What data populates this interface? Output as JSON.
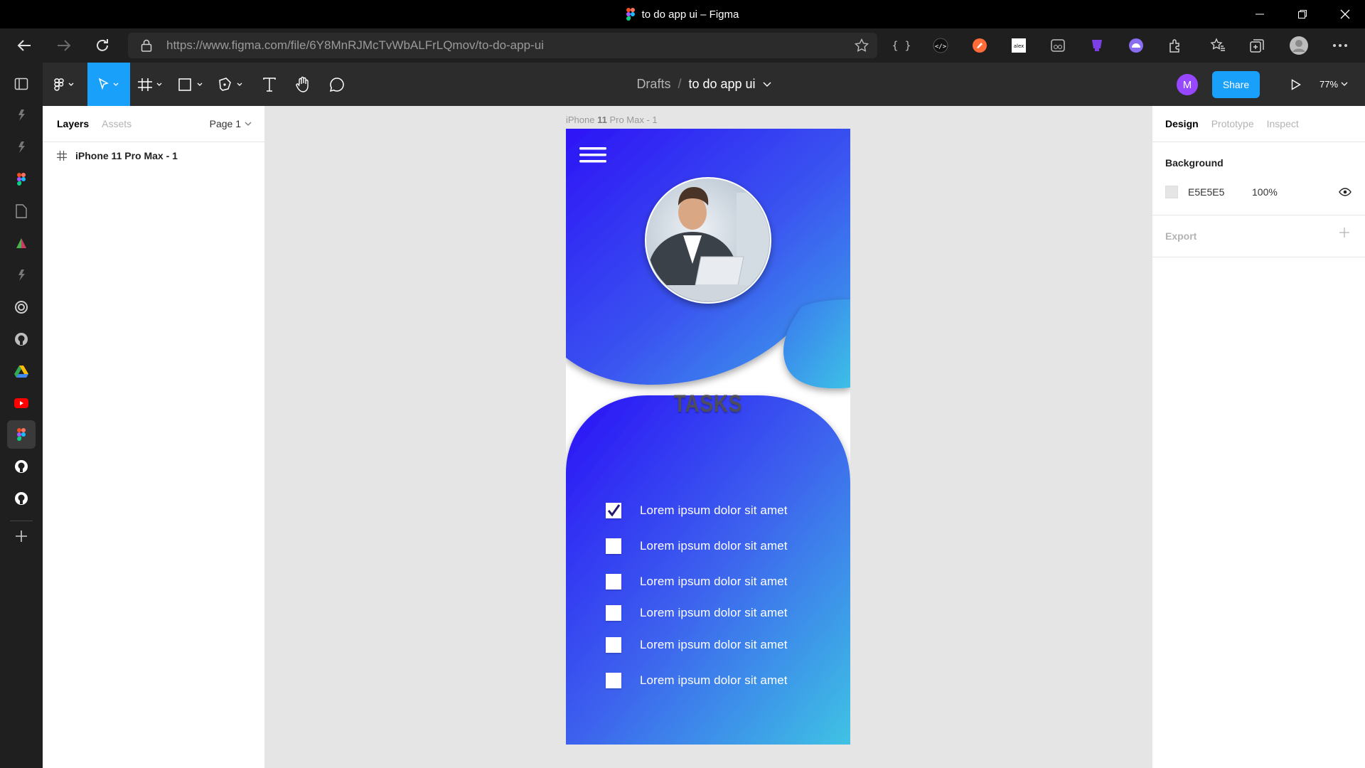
{
  "window": {
    "title": "to do app ui – Figma"
  },
  "browser": {
    "url": "https://www.figma.com/file/6Y8MnRJMcTvWbALFrLQmov/to-do-app-ui"
  },
  "figma": {
    "breadcrumb": {
      "drafts": "Drafts",
      "separator": "/",
      "file": "to do app ui"
    },
    "avatar_letter": "M",
    "share_label": "Share",
    "zoom": "77%"
  },
  "layers_panel": {
    "tabs": [
      "Layers",
      "Assets"
    ],
    "page": "Page 1",
    "items": [
      {
        "label": "iPhone 11 Pro Max - 1"
      }
    ]
  },
  "canvas": {
    "frame_label_prefix": "iPhone ",
    "frame_label_bold": "11",
    "frame_label_suffix": " Pro Max - 1",
    "screen_title": "TASKS",
    "tasks": [
      {
        "text": "Lorem ipsum dolor sit amet",
        "checked": true
      },
      {
        "text": "Lorem ipsum dolor sit amet",
        "checked": false
      },
      {
        "text": "Lorem ipsum dolor sit amet",
        "checked": false
      },
      {
        "text": "Lorem ipsum dolor sit amet",
        "checked": false
      },
      {
        "text": "Lorem ipsum dolor sit amet",
        "checked": false
      },
      {
        "text": "Lorem ipsum dolor sit amet",
        "checked": false
      }
    ],
    "help": "?"
  },
  "design_panel": {
    "tabs": [
      "Design",
      "Prototype",
      "Inspect"
    ],
    "background_title": "Background",
    "background_hex": "E5E5E5",
    "background_opacity": "100%",
    "export_title": "Export"
  },
  "colors": {
    "accent": "#18a0fb",
    "gradient_start": "#2d15f5",
    "gradient_end": "#3cbde6",
    "avatar": "#9747ff"
  }
}
